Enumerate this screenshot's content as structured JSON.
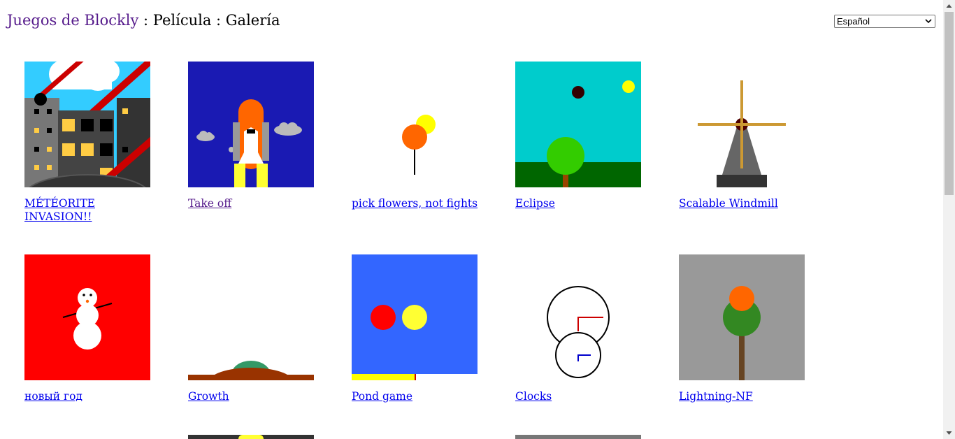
{
  "header": {
    "app_link": "Juegos de Blockly",
    "separator": " : ",
    "section": "Película",
    "page": "Galería"
  },
  "language_select": {
    "value": "Español"
  },
  "gallery": [
    {
      "title": "MÉTÉORITE INVASION!!",
      "thumbnail": "city-meteor-icon"
    },
    {
      "title": "Take off",
      "thumbnail": "space-shuttle-icon"
    },
    {
      "title": "pick flowers, not fights",
      "thumbnail": "flower-icon"
    },
    {
      "title": "Eclipse",
      "thumbnail": "eclipse-tree-icon"
    },
    {
      "title": "Scalable Windmill",
      "thumbnail": "windmill-icon"
    },
    {
      "title": "новый год",
      "thumbnail": "snowman-icon"
    },
    {
      "title": "Growth",
      "thumbnail": "growth-mound-icon"
    },
    {
      "title": "Pond game",
      "thumbnail": "pond-icon"
    },
    {
      "title": "Clocks",
      "thumbnail": "clocks-icon"
    },
    {
      "title": "Lightning-NF",
      "thumbnail": "orange-tree-icon"
    }
  ]
}
